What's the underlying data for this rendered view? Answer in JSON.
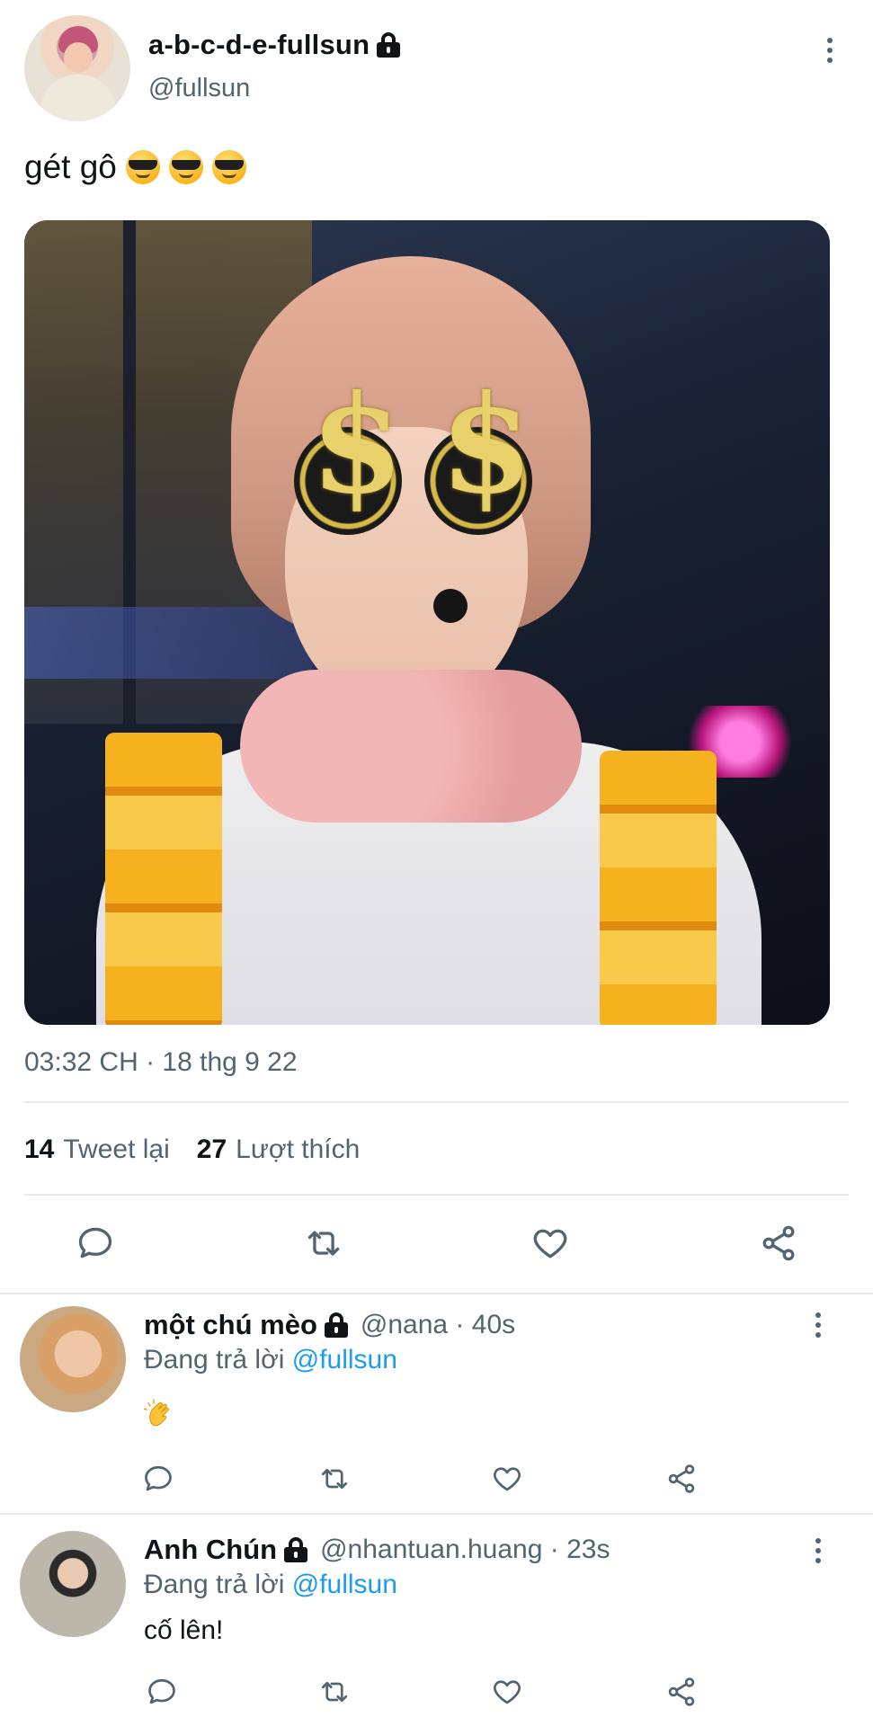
{
  "main_tweet": {
    "author_name": "a-b-c-d-e-fullsun",
    "handle": "@fullsun",
    "text": "gét gô",
    "emojis": [
      "smiling-face-with-sunglasses",
      "smiling-face-with-sunglasses",
      "smiling-face-with-sunglasses"
    ],
    "photo_subject": "",
    "photo_labels": [
      "$",
      "$"
    ],
    "timestamp": "03:32 CH · 18 thg 9 22",
    "retweets_count": "14",
    "retweets_label": "Tweet lại",
    "likes_count": "27",
    "likes_label": "Lượt thích"
  },
  "actions": [
    "reply-icon",
    "retweet-icon",
    "like-icon",
    "share-icon"
  ],
  "replies": [
    {
      "author_name": "một chú mèo",
      "handle": "@nana",
      "time": "40s",
      "replying_prefix": "Đang trả lời",
      "replying_to": "@fullsun",
      "text": "",
      "emoji": "clapping-hands"
    },
    {
      "author_name": "Anh Chún",
      "handle": "@nhantuan.huang",
      "time": "23s",
      "replying_prefix": "Đang trả lời",
      "replying_to": "@fullsun",
      "text": "cố lên!"
    }
  ],
  "colors": {
    "text_primary": "#0f1419",
    "text_secondary": "#536471",
    "link": "#1d9bf0",
    "divider": "#e6ecf0"
  }
}
